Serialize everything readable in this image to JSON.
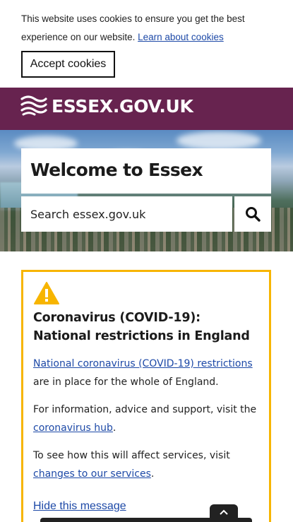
{
  "cookie_banner": {
    "text": "This website uses cookies to ensure you get the best experience on our website.",
    "link_label": "Learn about cookies",
    "accept_label": "Accept cookies"
  },
  "header": {
    "brand": "ESSEX.GOV.UK",
    "color": "#67234f"
  },
  "hero": {
    "title": "Welcome to Essex",
    "search_placeholder": "Search essex.gov.uk"
  },
  "alert": {
    "icon": "warning-triangle-icon",
    "border_color": "#f7b500",
    "title": "Coronavirus (COVID-19): National restrictions in England",
    "p1_link": "National coronavirus (COVID-19) restrictions",
    "p1_text": " are in place for the whole of England.",
    "p2_text": "For information, advice and support, visit the ",
    "p2_link": "coronavirus hub",
    "p2_end": ".",
    "p3_text": "To see how this will affect services, visit ",
    "p3_link": "changes to our services",
    "p3_end": ".",
    "hide_label": "Hide this message"
  },
  "link_color": "#1d49a7"
}
